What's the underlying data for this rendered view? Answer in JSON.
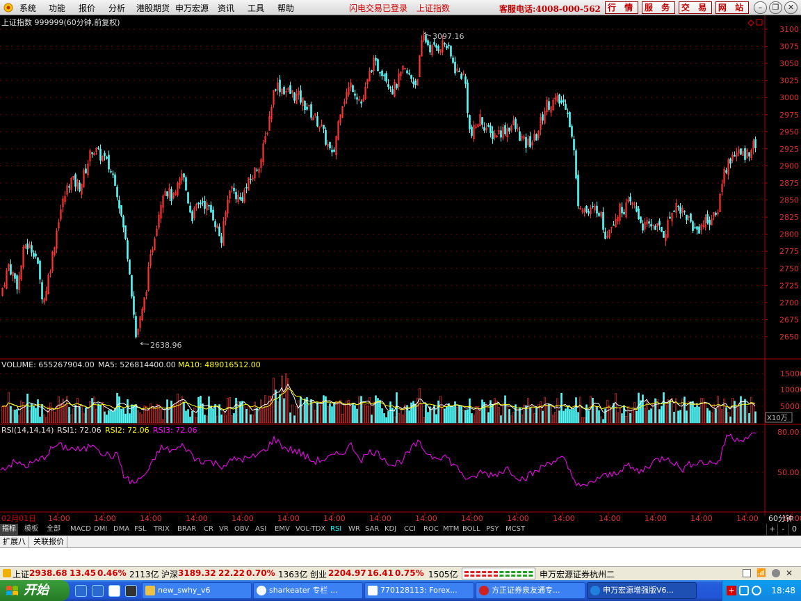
{
  "menubar": {
    "items": [
      "系统",
      "功能",
      "报价",
      "分析",
      "港股期货",
      "申万宏源",
      "资讯",
      "工具",
      "帮助"
    ],
    "status_login": "闪电交易已登录",
    "status_index": "上证指数",
    "hotline": "客服电话:4008-000-562",
    "buttons": [
      "行 情",
      "服 务",
      "交 易",
      "网 站"
    ]
  },
  "main_chart": {
    "title": "上证指数 999999(60分钟,前复权)",
    "y_ticks": [
      3100,
      3075,
      3050,
      3025,
      3000,
      2975,
      2950,
      2925,
      2900,
      2875,
      2850,
      2825,
      2800,
      2775,
      2750,
      2725,
      2700,
      2675,
      2650
    ],
    "high_label": "3097.16",
    "low_label": "2638.96",
    "up_color": "#ff3232",
    "down_color": "#54fcfc"
  },
  "volume_panel": {
    "label_volume": "VOLUME: 655267904.00",
    "label_ma5": "MA5: 526814400.00",
    "label_ma10": "MA10: 489016512.00",
    "y_ticks": [
      "15000",
      "10000",
      "5000"
    ],
    "unit": "X10万"
  },
  "rsi_panel": {
    "label_params": "RSI(14,14,14)",
    "label_rsi1": "RSI1: 72.06",
    "label_rsi2": "RSI2: 72.06",
    "label_rsi3": "RSI3: 72.06",
    "y_ticks": [
      "80.00",
      "50.00"
    ],
    "color": "#ff00ff"
  },
  "x_axis": {
    "first": "02月01日",
    "labels": [
      "14:00",
      "14:00",
      "14:00",
      "14:00",
      "14:00",
      "14:00",
      "14:00",
      "14:00",
      "14:00",
      "14:00",
      "14:00",
      "14:00",
      "14:00",
      "14:00",
      "14:00",
      "14:00",
      "14:00",
      "14:00"
    ],
    "period": "60分钟"
  },
  "indicators": {
    "items": [
      "指标",
      "模板",
      "全部",
      "MACD",
      "DMI",
      "DMA",
      "FSL",
      "TRIX",
      "BRAR",
      "CR",
      "VR",
      "OBV",
      "ASI",
      "EMV",
      "VOL-TDX",
      "RSI",
      "WR",
      "SAR",
      "KDJ",
      "CCI",
      "ROC",
      "MTM",
      "BOLL",
      "PSY",
      "MCST"
    ],
    "side_buttons": [
      "+",
      "-",
      "0"
    ]
  },
  "tabs": [
    "扩展八",
    "关联报价"
  ],
  "statusbar": {
    "sh_label": "上证",
    "sh_value": "2938.68",
    "sh_change": "13.45",
    "sh_pct": "0.46%",
    "sh_amount": "2113亿",
    "hs_label": "沪深",
    "hs_value": "3189.32",
    "hs_change": "22.22",
    "hs_pct": "0.70%",
    "hs_amount": "1363亿",
    "cy_label": "创业",
    "cy_value": "2204.97",
    "cy_change": "16.41",
    "cy_pct": "0.75%",
    "cy_amount": "1505亿",
    "broker": "申万宏源证券杭州二"
  },
  "taskbar": {
    "start": "开始",
    "tasks": [
      "new_swhy_v6",
      "sharkeater 专栏 ...",
      "770128113: Forex...",
      "方正证券泉友通专...",
      "申万宏源增强版V6..."
    ],
    "clock": "18:48"
  }
}
